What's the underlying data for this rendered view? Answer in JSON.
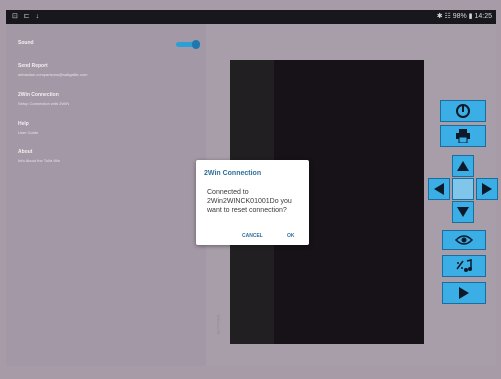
{
  "status_bar": {
    "left_icons": "⊡ ⊏ ↓",
    "right_text": "✱ ☷ 98% ▮ 14:25"
  },
  "drawer": {
    "items": [
      {
        "title": "Sound",
        "subtitle": ""
      },
      {
        "title": "Send Report",
        "subtitle": "sebastian.comparisons@saltgalite.com"
      },
      {
        "title": "2Win Connection",
        "subtitle": "Setup Connection with 2WIN"
      },
      {
        "title": "Help",
        "subtitle": "User Guide"
      },
      {
        "title": "About",
        "subtitle": "Info About the Tulla Win"
      }
    ],
    "sound_toggle_on": true
  },
  "screen": {
    "vertical_label": "SETTINGS"
  },
  "dialog": {
    "title": "2Win Connection",
    "message": "Connected to 2Win2WINCK01001Do you want to reset connection?",
    "cancel_label": "CANCEL",
    "ok_label": "OK"
  },
  "controls": {
    "color": "#3aaee5",
    "buttons": [
      "power-icon",
      "printer-icon",
      "arrow-up-icon",
      "arrow-left-icon",
      "arrow-right-icon",
      "arrow-down-icon",
      "eye-icon",
      "music-note-icon",
      "play-icon"
    ]
  }
}
